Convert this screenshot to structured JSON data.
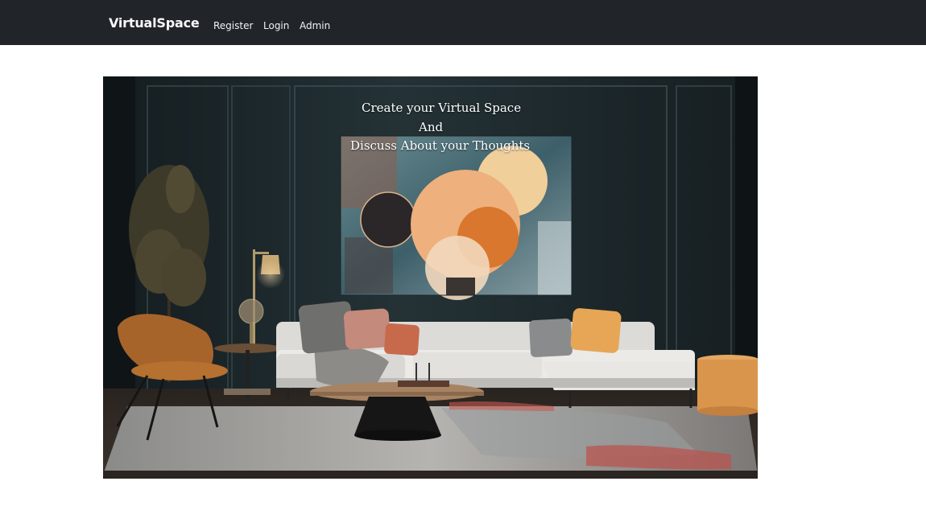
{
  "navbar": {
    "brand": "VirtualSpace",
    "links": [
      {
        "label": "Register"
      },
      {
        "label": "Login"
      },
      {
        "label": "Admin"
      }
    ]
  },
  "hero": {
    "lines": [
      "Create your Virtual Space",
      "And",
      "Discuss About your Thoughts"
    ]
  },
  "colors": {
    "navbar_bg": "#212529",
    "nav_text": "#f8f9fa",
    "wall": "#1f2a2e",
    "sofa": "#d9d9d6",
    "accent_orange": "#e3a458",
    "page_bg": "#ffffff"
  }
}
